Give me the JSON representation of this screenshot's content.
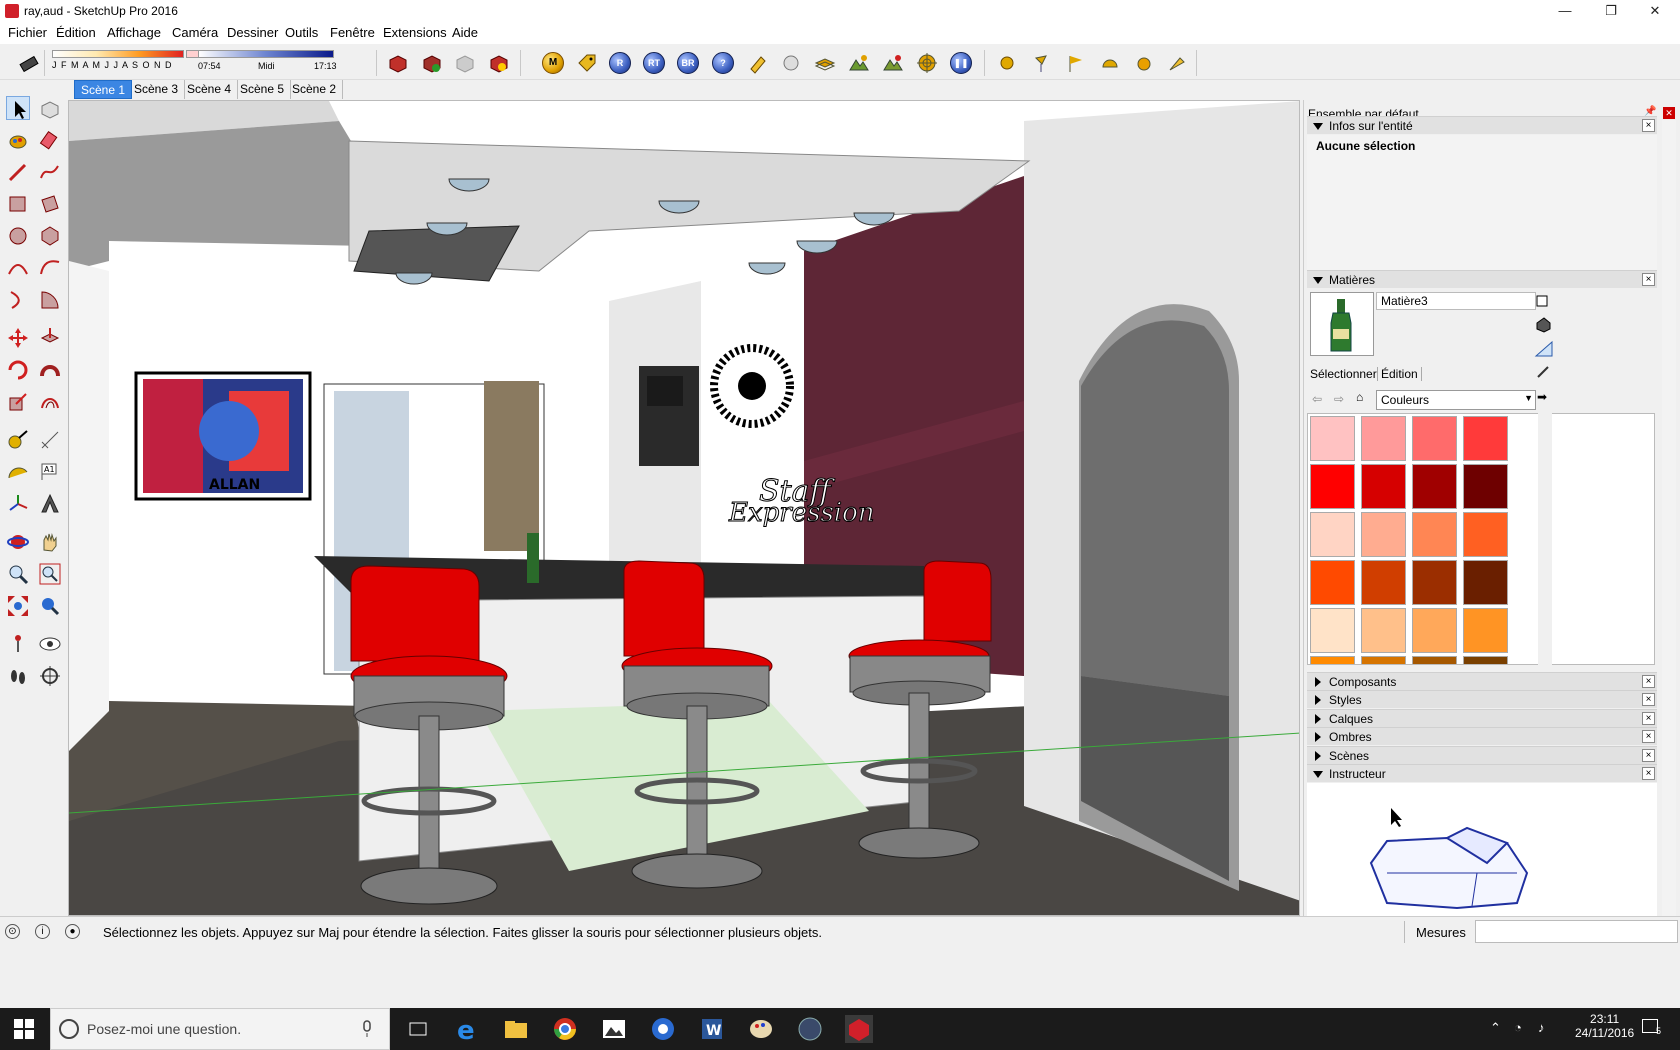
{
  "window": {
    "title": "ray,aud - SketchUp Pro 2016",
    "minimize": "—",
    "restore": "❐",
    "close": "✕"
  },
  "menu": [
    "Fichier",
    "Édition",
    "Affichage",
    "Caméra",
    "Dessiner",
    "Outils",
    "Fenêtre",
    "Extensions",
    "Aide"
  ],
  "shadows": {
    "months": "J F M A M J J A S O N D",
    "time_start": "07:54",
    "time_mid": "Midi",
    "time_end": "17:13"
  },
  "toolbar_plugins": [
    "M",
    "R",
    "RT",
    "BR",
    "?"
  ],
  "scene_tabs": [
    {
      "label": "Scène 1",
      "active": true
    },
    {
      "label": "Scène 3",
      "active": false
    },
    {
      "label": "Scène 4",
      "active": false
    },
    {
      "label": "Scène 5",
      "active": false
    },
    {
      "label": "Scène 2",
      "active": false
    }
  ],
  "viewport": {
    "watermark_line1": "Staff",
    "watermark_line2": "Expression",
    "poster_text": "ALLAN"
  },
  "panel": {
    "tray_title": "Ensemble par défaut",
    "entity_info": {
      "title": "Infos sur l'entité",
      "selection": "Aucune sélection"
    },
    "materials": {
      "title": "Matières",
      "name": "Matière3",
      "tab_select": "Sélectionner",
      "tab_edit": "Édition",
      "library": "Couleurs",
      "swatches": [
        "#ffc2c2",
        "#ff9a9a",
        "#ff6b6b",
        "#ff3a3a",
        "#ff0000",
        "#d60000",
        "#a00000",
        "#6e0000",
        "#ffd4c4",
        "#ffac90",
        "#ff8654",
        "#ff6022",
        "#ff4a00",
        "#d03e00",
        "#9b2e00",
        "#6a1f00",
        "#ffe3c8",
        "#ffc08a",
        "#ffa85a",
        "#ff9424",
        "#ff8a00",
        "#d67400",
        "#a65800",
        "#7a4000"
      ]
    },
    "collapsed": [
      "Composants",
      "Styles",
      "Calques",
      "Ombres",
      "Scènes"
    ],
    "instructor": {
      "title": "Instructeur"
    }
  },
  "status": {
    "message": "Sélectionnez les objets. Appuyez sur Maj pour étendre la sélection. Faites glisser la souris pour sélectionner plusieurs objets.",
    "measures_label": "Mesures",
    "measures_value": ""
  },
  "taskbar": {
    "search_placeholder": "Posez-moi une question.",
    "time": "23:11",
    "date": "24/11/2016",
    "notifications": "5"
  },
  "colors": {
    "accent": "#3b86e3",
    "wall_red": "#5e2636",
    "stool_red": "#e00000"
  }
}
